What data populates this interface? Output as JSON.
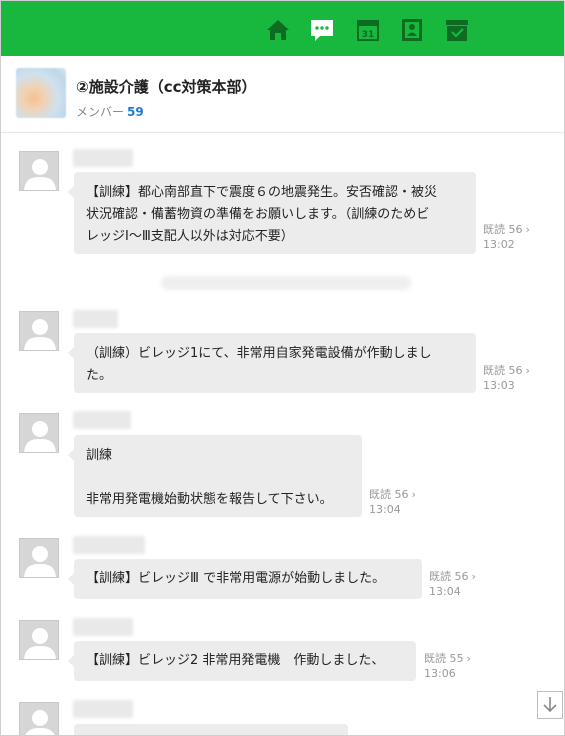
{
  "nav": {
    "items": [
      {
        "icon": "home-icon"
      },
      {
        "icon": "chat-icon",
        "active": true
      },
      {
        "icon": "calendar-icon",
        "label": "31"
      },
      {
        "icon": "address-book-icon"
      },
      {
        "icon": "inbox-icon"
      }
    ],
    "colors": {
      "bar": "#18b83f",
      "icon": "#0d6b22",
      "active_icon": "#ffffff"
    }
  },
  "group": {
    "title": "②施設介護（cc対策本部）",
    "member_label": "メンバー",
    "member_count": "59"
  },
  "messages": [
    {
      "lines": [
        "【訓練】都心南部直下で震度６の地震発生。安否確認・被災",
        "状況確認・備蓄物資の準備をお願いします。（訓練のためビ",
        "レッジⅠ～Ⅲ支配人以外は対応不要）"
      ],
      "read": "既読 56",
      "time": "13:02"
    },
    {
      "lines": [
        "（訓練）ビレッジ1にて、非常用自家発電設備が作動しまし",
        "た。"
      ],
      "read": "既読 56",
      "time": "13:03"
    },
    {
      "lines": [
        "訓練",
        "",
        "非常用発電機始動状態を報告して下さい。"
      ],
      "read": "既読 56",
      "time": "13:04"
    },
    {
      "lines": [
        "【訓練】ビレッジⅢ で非常用電源が始動しました。"
      ],
      "read": "既読 56",
      "time": "13:04"
    },
    {
      "lines": [
        "【訓練】ビレッジ2 非常用発電機　作動しました、"
      ],
      "read": "既読 55",
      "time": "13:06"
    }
  ],
  "icons": {
    "read_chevron": "chevron-right-icon",
    "scroll": "arrow-down-icon",
    "avatar": "default-user-icon"
  }
}
